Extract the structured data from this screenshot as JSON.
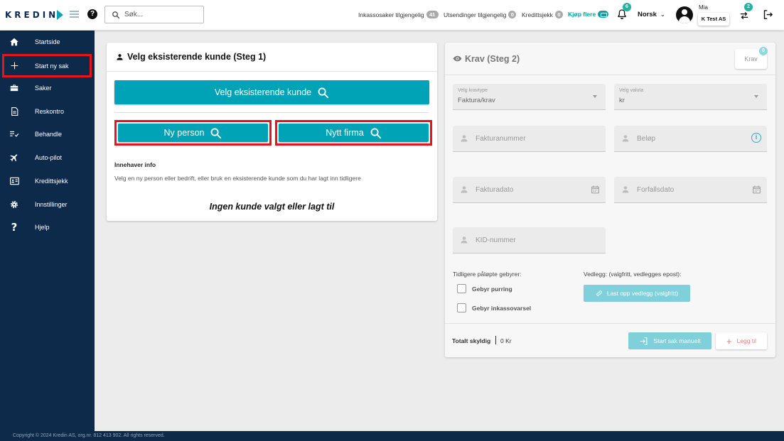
{
  "brand": {
    "logo_text": "KREDIN",
    "accent": "#00a2b5",
    "sidebar_bg": "#0e2a4a",
    "highlight": "#e8141b"
  },
  "topbar": {
    "search_placeholder": "Søk...",
    "inkasso_label": "Inkassosaker tilgjengelig",
    "inkasso_count": "41",
    "utsendinger_label": "Utsendinger tilgjengelig",
    "utsendinger_count": "0",
    "kredittsjekk_label": "Kredittsjekk",
    "kredittsjekk_count": "0",
    "buy_more": "Kjøp flere",
    "notifications_count": "6",
    "language": "Norsk",
    "user_name": "Mia",
    "company": "K Test AS",
    "switch_count": "2"
  },
  "sidebar": {
    "items": [
      {
        "label": "Startside",
        "icon": "home-icon"
      },
      {
        "label": "Start ny sak",
        "icon": "plus-icon"
      },
      {
        "label": "Saker",
        "icon": "briefcase-icon"
      },
      {
        "label": "Reskontro",
        "icon": "document-icon"
      },
      {
        "label": "Behandle",
        "icon": "checklist-icon"
      },
      {
        "label": "Auto-pilot",
        "icon": "airplane-icon"
      },
      {
        "label": "Kredittsjekk",
        "icon": "id-card-icon"
      },
      {
        "label": "Innstillinger",
        "icon": "gear-icon"
      },
      {
        "label": "Hjelp",
        "icon": "question-icon"
      }
    ]
  },
  "step1": {
    "title": "Velg eksisterende kunde (Steg 1)",
    "select_existing": "Velg eksisterende kunde",
    "new_person": "Ny person",
    "new_company": "Nytt firma",
    "owner_title": "Innehaver info",
    "owner_desc": "Velg en ny person eller bedrift, eller bruk en eksisterende kunde som du har lagt inn tidligere",
    "no_customer": "Ingen kunde valgt eller lagt til"
  },
  "step2": {
    "title": "Krav (Steg 2)",
    "krav_chip": "Krav",
    "krav_count": "0",
    "claim_type_label": "Velg kravtype",
    "claim_type_value": "Faktura/krav",
    "currency_label": "Velg valuta",
    "currency_value": "kr",
    "invoice_number": "Fakturanummer",
    "amount": "Beløp",
    "invoice_date": "Fakturadato",
    "due_date": "Forfallsdato",
    "kid_number": "KID-nummer",
    "fees_label": "Tidligere påløpte gebyrer:",
    "fee_reminder": "Gebyr purring",
    "fee_collection_notice": "Gebyr inkassovarsel",
    "attachment_label": "Vedlegg: (valgfritt, vedlegges epost):",
    "upload_button": "Last opp vedlegg (valgfritt)",
    "total_label": "Totalt skyldig",
    "total_value": "0 Kr",
    "start_manual": "Start sak manuelt",
    "add_button": "Legg til"
  },
  "footer": {
    "copyright": "Copyright © 2024 Kredin AS, org.nr. 812 413 902. All rights reserved."
  }
}
